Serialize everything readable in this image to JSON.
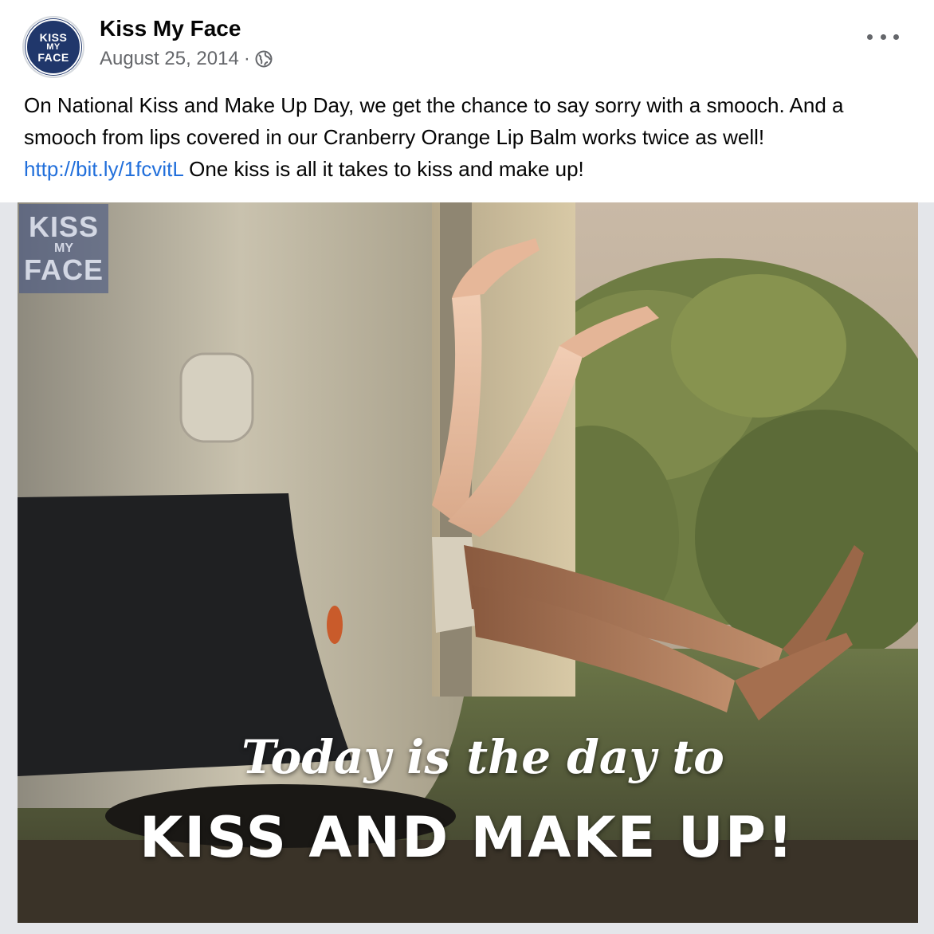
{
  "post": {
    "page_name": "Kiss My Face",
    "date": "August 25, 2014",
    "separator": "·",
    "privacy_icon": "globe-icon",
    "more_icon": "more-options-icon",
    "avatar": {
      "line1": "KISS",
      "line2": "MY",
      "line3": "FACE",
      "color": "#20376b"
    },
    "text_before_link": "On National Kiss and Make Up Day, we get the chance to say sorry with a smooch. And a smooch from lips covered in our Cranberry Orange Lip Balm works twice as well! ",
    "link": "http://bit.ly/1fcvitL",
    "text_after_link": " One kiss is all it takes to kiss and make up!",
    "link_color": "#216fdb"
  },
  "photo": {
    "logo": {
      "line1": "KISS",
      "line2": "MY",
      "line3": "FACE"
    },
    "caption_script": "Today is the day to",
    "caption_bold": "KISS AND MAKE UP!"
  }
}
